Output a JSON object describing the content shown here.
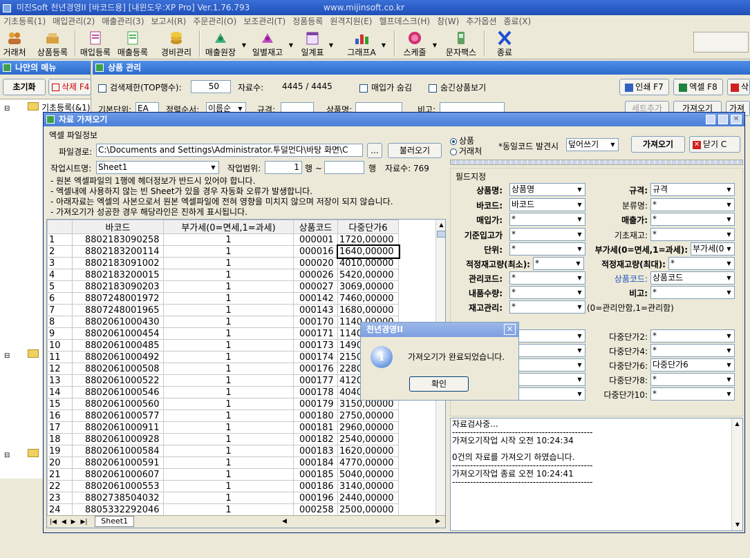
{
  "main_title": "미진Soft 천년경영II [바코드용] [내윈도우:XP Pro] Ver.1.76.793",
  "main_url": "www.mijinsoft.co.kr",
  "menu": [
    "기초등록(1)",
    "매입관리(2)",
    "매출관리(3)",
    "보고서(R)",
    "주문관리(O)",
    "보조관리(T)",
    "정품등록",
    "원격지원(E)",
    "헬프데스크(H)",
    "창(W)",
    "추가옵션",
    "종료(X)"
  ],
  "toolbar": [
    {
      "label": "거래처",
      "icon": "people-icon"
    },
    {
      "label": "상품등록",
      "icon": "goods-icon"
    },
    {
      "label": "매입등록",
      "icon": "purchase-icon"
    },
    {
      "label": "매출등록",
      "icon": "sales-icon"
    },
    {
      "label": "경비관리",
      "icon": "coins-icon"
    },
    {
      "label": "매출원장",
      "icon": "ledger-icon"
    },
    {
      "label": "일별재고",
      "icon": "inventory-icon"
    },
    {
      "label": "일계표",
      "icon": "daily-icon"
    },
    {
      "label": "그래프A",
      "icon": "chart-icon"
    },
    {
      "label": "스케줄",
      "icon": "schedule-icon"
    },
    {
      "label": "문자팩스",
      "icon": "phone-icon"
    },
    {
      "label": "종료",
      "icon": "exit-icon"
    }
  ],
  "mymenu": {
    "title": "나만의 메뉴",
    "reset": "초기화",
    "delete": "삭제 F4",
    "tree_root": "기초등록(&1)"
  },
  "product": {
    "title": "상품 관리",
    "limit_label": "검색제한(TOP행수):",
    "limit_value": "50",
    "count_label": "자료수:",
    "count_value": "4445 /    4445",
    "hide_purchase": "매입가 숨김",
    "show_hidden": "숨긴상품보기",
    "print": "인쇄 F7",
    "excel": "엑셀 F8",
    "del_partial": "삭",
    "row2": {
      "unit_label": "기본단위:",
      "unit_value": "EA",
      "sort_label": "정렬순서:",
      "sort_value": "이름순",
      "spec_label": "규격:",
      "name_label": "상품명:",
      "note_label": "비고:",
      "set_add": "세트추가",
      "import": "가져오기",
      "partial": "가져"
    }
  },
  "importdlg": {
    "title": "자료 가져오기",
    "excel_info": "엑셀 파일정보",
    "path_label": "파일경로:",
    "path_value": "C:\\Documents and Settings\\Administrator.투덜먼다\\바탕 화면\\C",
    "browse": "...",
    "load": "불러오기",
    "sheet_label": "작업시트명:",
    "sheet_value": "Sheet1",
    "range_label": "작업범위:",
    "range_from": "1",
    "range_row": "행 ~",
    "range_row2": "행",
    "data_count": "자료수:  769",
    "notes": [
      "- 원본 엑셀파일의 1행에 헤더정보가 반드시 있어야 합니다.",
      "- 엑셀내에 사용하지 않는 빈 Sheet가 있을 경우 자동화 오류가 발생합니다.",
      "- 아래자료는 엑셀의 사본으로서 원본 엑셀파일에 전혀 영향을 미치지 않으며 저장이 되지 않습니다.",
      "- 가져오기가 성공한 경우 해당라인은 진하게 표시됩니다."
    ],
    "target_product": "상품",
    "target_customer": "거래처",
    "dup_label": "*동일코드 발견시",
    "dup_value": "덮어쓰기",
    "import_btn": "가져오기",
    "close_btn": "닫기 C"
  },
  "grid": {
    "headers": [
      "",
      "바코드",
      "부가세(0=면세,1=과세)",
      "상품코드",
      "다중단가6"
    ],
    "rows": [
      [
        "1",
        "8802183090258",
        "1",
        "000001",
        "1720,00000"
      ],
      [
        "2",
        "8802183200114",
        "1",
        "000016",
        "1640,00000"
      ],
      [
        "3",
        "8802183091002",
        "1",
        "000020",
        "4010,00000"
      ],
      [
        "4",
        "8802183200015",
        "1",
        "000026",
        "5420,00000"
      ],
      [
        "5",
        "8802183090203",
        "1",
        "000027",
        "3069,00000"
      ],
      [
        "6",
        "8807248001972",
        "1",
        "000142",
        "7460,00000"
      ],
      [
        "7",
        "8807248001965",
        "1",
        "000143",
        "1680,00000"
      ],
      [
        "8",
        "8802061000430",
        "1",
        "000170",
        "1140,00000"
      ],
      [
        "9",
        "8802061000454",
        "1",
        "000171",
        "1140"
      ],
      [
        "10",
        "8802061000485",
        "1",
        "000173",
        "1490"
      ],
      [
        "11",
        "8802061000492",
        "1",
        "000174",
        "2150"
      ],
      [
        "12",
        "8802061000508",
        "1",
        "000176",
        "2280"
      ],
      [
        "13",
        "8802061000522",
        "1",
        "000177",
        "4120"
      ],
      [
        "14",
        "8802061000546",
        "1",
        "000178",
        "4040"
      ],
      [
        "15",
        "8802061000560",
        "1",
        "000179",
        "3150,00000"
      ],
      [
        "16",
        "8802061000577",
        "1",
        "000180",
        "2750,00000"
      ],
      [
        "17",
        "8802061000911",
        "1",
        "000181",
        "2960,00000"
      ],
      [
        "18",
        "8802061000928",
        "1",
        "000182",
        "2540,00000"
      ],
      [
        "19",
        "8802061000584",
        "1",
        "000183",
        "1620,00000"
      ],
      [
        "20",
        "8802061000591",
        "1",
        "000184",
        "4770,00000"
      ],
      [
        "21",
        "8802061000607",
        "1",
        "000185",
        "5040,00000"
      ],
      [
        "22",
        "8802061000553",
        "1",
        "000186",
        "3140,00000"
      ],
      [
        "23",
        "8802738504032",
        "1",
        "000196",
        "2440,00000"
      ],
      [
        "24",
        "8805332292046",
        "1",
        "000258",
        "2500,00000"
      ]
    ],
    "sheet_tab": "Sheet1"
  },
  "fields": {
    "title": "필드지정",
    "left": [
      {
        "label": "상품명:",
        "value": "상품명"
      },
      {
        "label": "바코드:",
        "value": "바코드"
      },
      {
        "label": "매입가:",
        "value": "*"
      },
      {
        "label": "기준입고가",
        "value": "*"
      },
      {
        "label": "단위:",
        "value": "*"
      },
      {
        "label": "적정재고량(최소):",
        "value": "*"
      },
      {
        "label": "관리코드:",
        "value": "*"
      },
      {
        "label": "내품수량:",
        "value": "*"
      },
      {
        "label": "재고관리:",
        "value": "*"
      }
    ],
    "right": [
      {
        "label": "규격:",
        "value": "규격"
      },
      {
        "label": "분류명:",
        "value": "*"
      },
      {
        "label": "매출가:",
        "value": "*"
      },
      {
        "label": "기초재고:",
        "value": "*"
      },
      {
        "label": "부가세(0=면세,1=과세):",
        "value": "부가세(0=면"
      },
      {
        "label": "적정재고량(최대):",
        "value": "*"
      },
      {
        "label": "상품코드:",
        "value": "상품코드"
      },
      {
        "label": "비고:",
        "value": "*"
      }
    ],
    "stock_hint": "(0=관리안함,1=관리함)",
    "multi": [
      {
        "label": "다중단가2:",
        "value": "*"
      },
      {
        "label": "다중단가4:",
        "value": "*"
      },
      {
        "label": "다중단가6:",
        "value": "다중단가6"
      },
      {
        "label": "다중단가8:",
        "value": "*"
      },
      {
        "label": "다중단가10:",
        "value": "*"
      }
    ]
  },
  "log": [
    "자료검사중...",
    "-----------------------------------------------",
    "가져오기작업 시작 오전 10:24:34",
    "",
    "0건의 자료를 가져오기 하였습니다.",
    "-----------------------------------------------",
    "가져오기작업 종료 오전 10:24:41",
    "-----------------------------------------------"
  ],
  "msgbox": {
    "title": "천년경영II",
    "message": "가져오기가 완료되었습니다.",
    "ok": "확인",
    "icon": "info-icon"
  },
  "colors": {
    "title_blue": "#2e6bcd",
    "selection": "#316ac5"
  }
}
